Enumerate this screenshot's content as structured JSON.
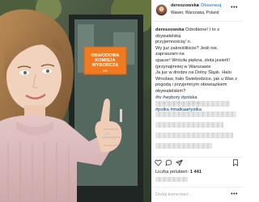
{
  "post": {
    "user": "dereszowska",
    "separator": "•",
    "follow_label": "Obserwuj",
    "location": "Wawer, Warszawa, Poland",
    "more_icon": "ellipsis-icon",
    "sign_line1": "OBWODOWA",
    "sign_line2": "KOMISJA WYBORCZA",
    "sign_line3": "NR"
  },
  "caption": {
    "user": "dereszowska",
    "lines": [
      "Odrobione! I to z obywatelską",
      "przyjemnością! n.",
      "Wy juz zakreśliliście? Jeśli nie, zapraszam na",
      "spacer! Wróciła piękna, złota jesień!!",
      "(przynajmniej w Warszawie",
      "Ja juz w drodze na Dolny Śląsk. Halo",
      "Wrocław, halo Świebodzice, jak u Was z",
      "pogodą i przyjemnym obowiązkiem",
      "obywatelskim?"
    ],
    "tags": [
      "#tv #wybory #polska #wyborysamorządowe",
      "#polka #matkaartystka"
    ]
  },
  "actions": {
    "like_icon": "heart-icon",
    "comment_icon": "comment-icon",
    "share_icon": "share-icon",
    "save_icon": "bookmark-icon"
  },
  "likes": {
    "label": "Liczba polubień:",
    "count": "1 441"
  },
  "comment_box": {
    "placeholder": "Dodaj komentarz..."
  }
}
